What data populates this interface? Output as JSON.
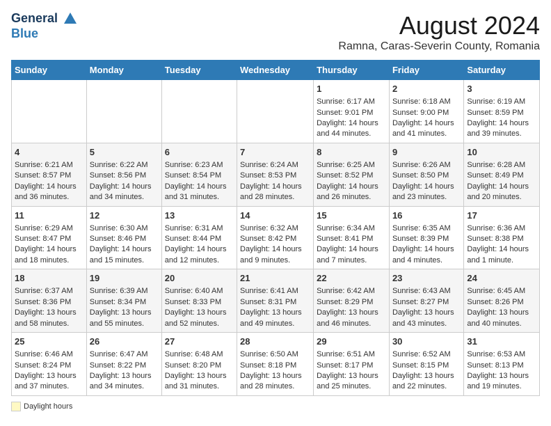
{
  "header": {
    "logo_line1": "General",
    "logo_line2": "Blue",
    "month_title": "August 2024",
    "subtitle": "Ramna, Caras-Severin County, Romania"
  },
  "days_of_week": [
    "Sunday",
    "Monday",
    "Tuesday",
    "Wednesday",
    "Thursday",
    "Friday",
    "Saturday"
  ],
  "weeks": [
    [
      {
        "day": "",
        "data": ""
      },
      {
        "day": "",
        "data": ""
      },
      {
        "day": "",
        "data": ""
      },
      {
        "day": "",
        "data": ""
      },
      {
        "day": "1",
        "data": "Sunrise: 6:17 AM\nSunset: 9:01 PM\nDaylight: 14 hours and 44 minutes."
      },
      {
        "day": "2",
        "data": "Sunrise: 6:18 AM\nSunset: 9:00 PM\nDaylight: 14 hours and 41 minutes."
      },
      {
        "day": "3",
        "data": "Sunrise: 6:19 AM\nSunset: 8:59 PM\nDaylight: 14 hours and 39 minutes."
      }
    ],
    [
      {
        "day": "4",
        "data": "Sunrise: 6:21 AM\nSunset: 8:57 PM\nDaylight: 14 hours and 36 minutes."
      },
      {
        "day": "5",
        "data": "Sunrise: 6:22 AM\nSunset: 8:56 PM\nDaylight: 14 hours and 34 minutes."
      },
      {
        "day": "6",
        "data": "Sunrise: 6:23 AM\nSunset: 8:54 PM\nDaylight: 14 hours and 31 minutes."
      },
      {
        "day": "7",
        "data": "Sunrise: 6:24 AM\nSunset: 8:53 PM\nDaylight: 14 hours and 28 minutes."
      },
      {
        "day": "8",
        "data": "Sunrise: 6:25 AM\nSunset: 8:52 PM\nDaylight: 14 hours and 26 minutes."
      },
      {
        "day": "9",
        "data": "Sunrise: 6:26 AM\nSunset: 8:50 PM\nDaylight: 14 hours and 23 minutes."
      },
      {
        "day": "10",
        "data": "Sunrise: 6:28 AM\nSunset: 8:49 PM\nDaylight: 14 hours and 20 minutes."
      }
    ],
    [
      {
        "day": "11",
        "data": "Sunrise: 6:29 AM\nSunset: 8:47 PM\nDaylight: 14 hours and 18 minutes."
      },
      {
        "day": "12",
        "data": "Sunrise: 6:30 AM\nSunset: 8:46 PM\nDaylight: 14 hours and 15 minutes."
      },
      {
        "day": "13",
        "data": "Sunrise: 6:31 AM\nSunset: 8:44 PM\nDaylight: 14 hours and 12 minutes."
      },
      {
        "day": "14",
        "data": "Sunrise: 6:32 AM\nSunset: 8:42 PM\nDaylight: 14 hours and 9 minutes."
      },
      {
        "day": "15",
        "data": "Sunrise: 6:34 AM\nSunset: 8:41 PM\nDaylight: 14 hours and 7 minutes."
      },
      {
        "day": "16",
        "data": "Sunrise: 6:35 AM\nSunset: 8:39 PM\nDaylight: 14 hours and 4 minutes."
      },
      {
        "day": "17",
        "data": "Sunrise: 6:36 AM\nSunset: 8:38 PM\nDaylight: 14 hours and 1 minute."
      }
    ],
    [
      {
        "day": "18",
        "data": "Sunrise: 6:37 AM\nSunset: 8:36 PM\nDaylight: 13 hours and 58 minutes."
      },
      {
        "day": "19",
        "data": "Sunrise: 6:39 AM\nSunset: 8:34 PM\nDaylight: 13 hours and 55 minutes."
      },
      {
        "day": "20",
        "data": "Sunrise: 6:40 AM\nSunset: 8:33 PM\nDaylight: 13 hours and 52 minutes."
      },
      {
        "day": "21",
        "data": "Sunrise: 6:41 AM\nSunset: 8:31 PM\nDaylight: 13 hours and 49 minutes."
      },
      {
        "day": "22",
        "data": "Sunrise: 6:42 AM\nSunset: 8:29 PM\nDaylight: 13 hours and 46 minutes."
      },
      {
        "day": "23",
        "data": "Sunrise: 6:43 AM\nSunset: 8:27 PM\nDaylight: 13 hours and 43 minutes."
      },
      {
        "day": "24",
        "data": "Sunrise: 6:45 AM\nSunset: 8:26 PM\nDaylight: 13 hours and 40 minutes."
      }
    ],
    [
      {
        "day": "25",
        "data": "Sunrise: 6:46 AM\nSunset: 8:24 PM\nDaylight: 13 hours and 37 minutes."
      },
      {
        "day": "26",
        "data": "Sunrise: 6:47 AM\nSunset: 8:22 PM\nDaylight: 13 hours and 34 minutes."
      },
      {
        "day": "27",
        "data": "Sunrise: 6:48 AM\nSunset: 8:20 PM\nDaylight: 13 hours and 31 minutes."
      },
      {
        "day": "28",
        "data": "Sunrise: 6:50 AM\nSunset: 8:18 PM\nDaylight: 13 hours and 28 minutes."
      },
      {
        "day": "29",
        "data": "Sunrise: 6:51 AM\nSunset: 8:17 PM\nDaylight: 13 hours and 25 minutes."
      },
      {
        "day": "30",
        "data": "Sunrise: 6:52 AM\nSunset: 8:15 PM\nDaylight: 13 hours and 22 minutes."
      },
      {
        "day": "31",
        "data": "Sunrise: 6:53 AM\nSunset: 8:13 PM\nDaylight: 13 hours and 19 minutes."
      }
    ]
  ],
  "legend": {
    "daylight_label": "Daylight hours"
  }
}
